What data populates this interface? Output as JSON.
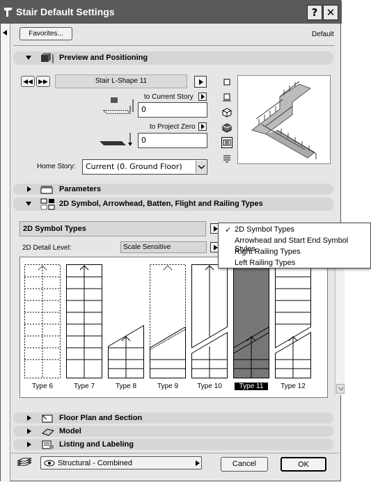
{
  "window": {
    "title": "Stair Default Settings",
    "help_btn": "?",
    "close_btn": "✕"
  },
  "header": {
    "favorites": "Favorites...",
    "default_label": "Default"
  },
  "sections": {
    "preview": "Preview and Positioning",
    "parameters": "Parameters",
    "symbol": "2D Symbol, Arrowhead, Batten, Flight and Railing Types",
    "floorplan": "Floor Plan and Section",
    "model": "Model",
    "listing": "Listing and Labeling"
  },
  "preview": {
    "stair_name": "Stair L-Shape 11",
    "to_current_story_label": "to Current Story",
    "to_current_story_value": "0",
    "to_project_zero_label": "to Project Zero",
    "to_project_zero_value": "0",
    "home_story_label": "Home Story:",
    "home_story_value": "Current (0. Ground Floor)"
  },
  "symbol": {
    "types_dropdown": "2D Symbol Types",
    "detail_label": "2D Detail Level:",
    "detail_value": "Scale Sensitive",
    "tiles": [
      "Type 6",
      "Type 7",
      "Type 8",
      "Type 9",
      "Type 10",
      "Type 11",
      "Type 12"
    ],
    "selected_tile": "Type 11"
  },
  "popup": {
    "items": [
      "2D Symbol Types",
      "Arrowhead and Start End Symbol Styles",
      "Right Railing Types",
      "Left Railing Types"
    ],
    "checkmark": "✓"
  },
  "footer": {
    "layer": "Structural - Combined",
    "cancel": "Cancel",
    "ok": "OK"
  }
}
